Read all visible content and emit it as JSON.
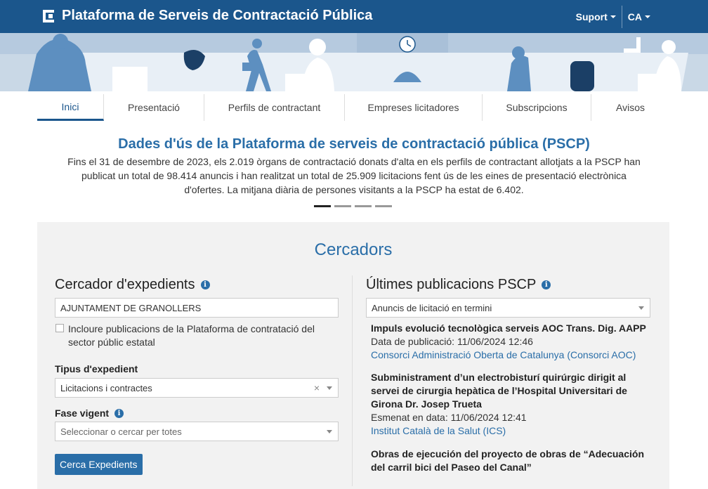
{
  "header": {
    "title": "Plataforma de Serveis de Contractació Pública",
    "support_label": "Suport",
    "lang_label": "CA"
  },
  "tabs": [
    "Inici",
    "Presentació",
    "Perfils de contractant",
    "Empreses licitadores",
    "Subscripcions",
    "Avisos"
  ],
  "hero": {
    "title": "Dades d'ús de la Plataforma de serveis de contractació pública (PSCP)",
    "text": "Fins el 31 de desembre de 2023, els 2.019 òrgans de contractació donats d'alta en els perfils de contractant allotjats a la PSCP han publicat un total de 98.414 anuncis i han realitzat un total de 25.909 licitacions fent ús de les eines de presentació electrònica d'ofertes. La mitjana diària de persones visitants a la PSCP ha estat de 6.402."
  },
  "search": {
    "section_title": "Cercadors",
    "title": "Cercador d'expedients",
    "input_value": "AJUNTAMENT DE GRANOLLERS",
    "checkbox_label": "Incloure publicacions de la Plataforma de contratació del sector públic estatal",
    "type_label": "Tipus d'expedient",
    "type_value": "Licitacions i contractes",
    "phase_label": "Fase vigent",
    "phase_placeholder": "Seleccionar o cercar per totes",
    "button_label": "Cerca Expedients"
  },
  "latest": {
    "title": "Últimes publicacions PSCP",
    "filter_value": "Anuncis de licitació en termini",
    "items": [
      {
        "title": "Impuls evolució tecnològica serveis AOC Trans. Dig. AAPP",
        "date": "Data de publicació: 11/06/2024 12:46",
        "org": "Consorci Administració Oberta de Catalunya (Consorci AOC)"
      },
      {
        "title": "Subministrament d’un electrobisturí quirúrgic dirigit al servei de cirurgia hepàtica de l’Hospital Universitari de Girona Dr. Josep Trueta",
        "date": "Esmenat en data: 11/06/2024 12:41",
        "org": "Institut Català de la Salut (ICS)"
      },
      {
        "title": "Obras de ejecución del proyecto de obras de “Adecuación del carril bici del Paseo del Canal”",
        "date": "",
        "org": ""
      }
    ]
  },
  "colors": {
    "brand": "#1b568c",
    "accent": "#2a6ea8"
  }
}
